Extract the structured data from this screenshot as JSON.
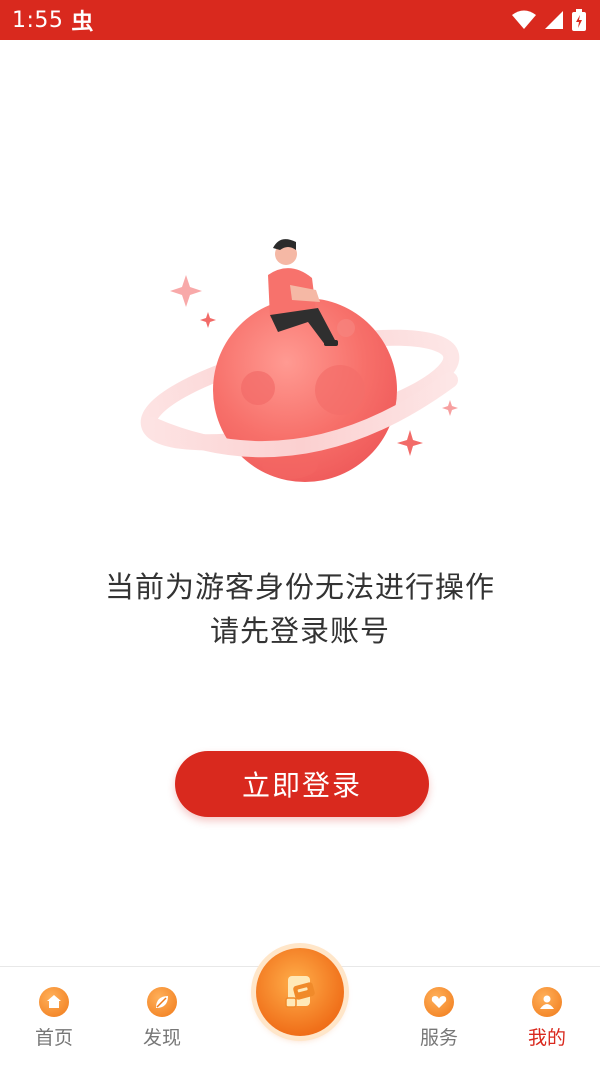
{
  "status_bar": {
    "time": "1:55",
    "app_icon_glyph": "虫",
    "icons": [
      "wifi-icon",
      "signal-icon",
      "battery-charging-icon"
    ]
  },
  "message": {
    "line1": "当前为游客身份无法进行操作",
    "line2": "请先登录账号"
  },
  "login_button": {
    "label": "立即登录"
  },
  "bottom_nav": {
    "items": [
      {
        "label": "首页",
        "icon": "home-icon",
        "active": false
      },
      {
        "label": "发现",
        "icon": "leaf-icon",
        "active": false
      },
      {
        "label": "",
        "icon": "center-app-icon",
        "active": false
      },
      {
        "label": "服务",
        "icon": "heart-hand-icon",
        "active": false
      },
      {
        "label": "我的",
        "icon": "profile-icon",
        "active": true
      }
    ]
  },
  "colors": {
    "primary": "#d9291e",
    "nav_icon": "#f07a1a",
    "text": "#333333",
    "inactive_label": "#777777"
  }
}
